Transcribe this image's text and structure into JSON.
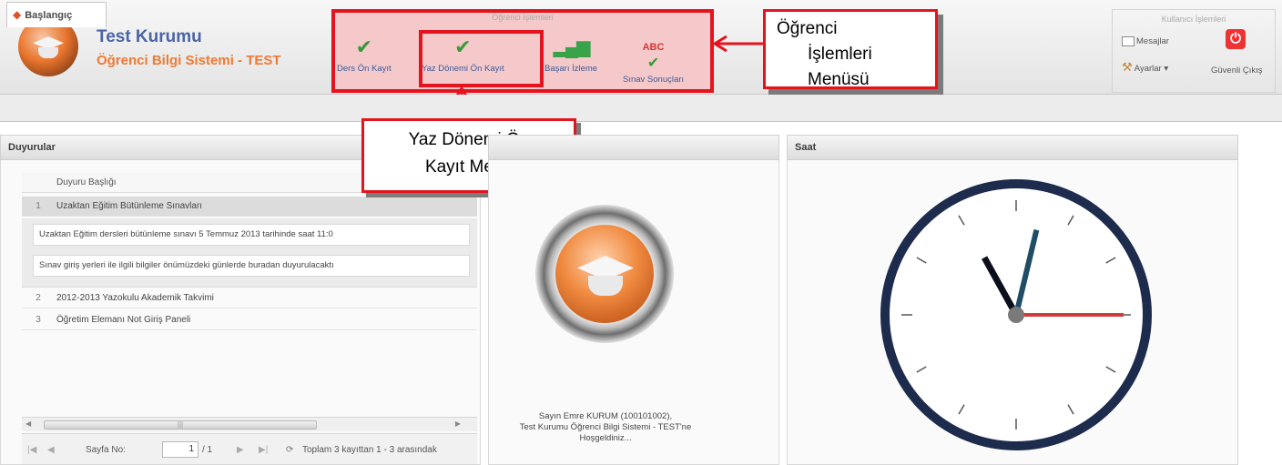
{
  "header": {
    "title": "Test Kurumu",
    "subtitle": "Öğrenci Bilgi Sistemi - TEST",
    "student_group": {
      "title": "Öğrenci İşlemleri",
      "buttons": [
        {
          "label": "Ders Ön Kayıt",
          "icon": "check-icon"
        },
        {
          "label": "Yaz Dönemi Ön Kayıt",
          "icon": "check-icon"
        },
        {
          "label": "Başarı İzleme",
          "icon": "bar-chart-icon"
        },
        {
          "label": "Sınav Sonuçları",
          "icon": "abc-check-icon"
        }
      ]
    },
    "user_group": {
      "title": "Kullanıcı İşlemleri",
      "messages": "Mesajlar",
      "settings": "Ayarlar",
      "logout": "Güvenli Çıkış"
    }
  },
  "callouts": {
    "menu_line1": "Öğrenci",
    "menu_line2": "İşlemleri",
    "menu_line3": "Menüsü",
    "summer_line1": "Yaz Dönemi Ön",
    "summer_line2": "Kayıt Menü"
  },
  "tabs": {
    "start": "Başlangıç"
  },
  "announcements": {
    "panel_title": "Duyurular",
    "column_header": "Duyuru Başlığı",
    "rows": [
      {
        "num": "1",
        "title": "Uzaktan Eğitim Bütünleme Sınavları"
      },
      {
        "num": "2",
        "title": "2012-2013 Yazokulu Akademik Takvimi"
      },
      {
        "num": "3",
        "title": "Öğretim Elemanı Not Giriş Paneli"
      }
    ],
    "detail_lines": [
      "Uzaktan Eğitim dersleri bütünleme sınavı 5 Temmuz 2013 tarihinde saat 11:0",
      "Sınav giriş yerleri ile ilgili bilgiler önümüzdeki günlerde buradan duyurulacaktı"
    ],
    "pager": {
      "page_label": "Sayfa No:",
      "page_value": "1",
      "page_total": "/ 1",
      "summary": "Toplam 3 kayıttan 1 - 3 arasındak"
    }
  },
  "welcome": {
    "line1": "Sayın Emre KURUM (100101002),",
    "line2": "Test Kurumu Öğrenci Bilgi Sistemi - TEST'ne",
    "line3": "Hoşgeldiniz..."
  },
  "clock": {
    "panel_title": "Saat",
    "time": "11:02:15"
  },
  "colors": {
    "annotation_red": "#e3141e",
    "title_blue": "#4a64a6",
    "subtitle_orange": "#ee7a34",
    "clock_frame": "#1d2b4d",
    "second_hand": "#d23b3b"
  }
}
